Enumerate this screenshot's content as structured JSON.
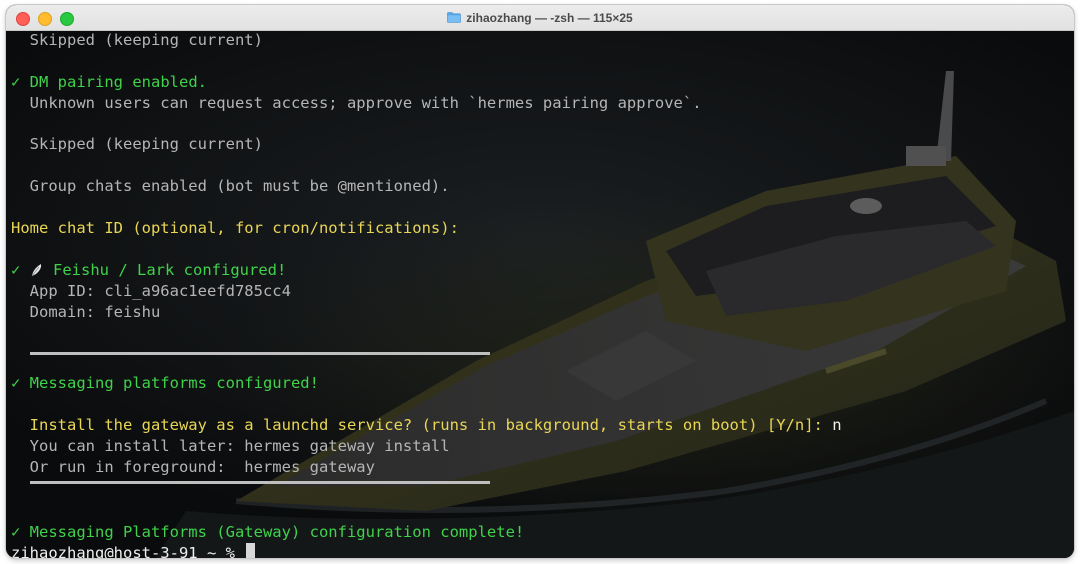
{
  "window": {
    "title": "zihaozhang — -zsh — 115×25"
  },
  "terminal": {
    "lines": [
      {
        "prefix": "",
        "text": "  Skipped (keeping current)",
        "color": "gray"
      },
      {
        "prefix": "",
        "text": "",
        "color": "gray"
      },
      {
        "prefix": "✓",
        "text": " DM pairing enabled.",
        "color": "green"
      },
      {
        "prefix": "",
        "text": "  Unknown users can request access; approve with `hermes pairing approve`.",
        "color": "gray"
      },
      {
        "prefix": "",
        "text": "",
        "color": "gray"
      },
      {
        "prefix": "",
        "text": "  Skipped (keeping current)",
        "color": "gray"
      },
      {
        "prefix": "",
        "text": "",
        "color": "gray"
      },
      {
        "prefix": "",
        "text": "  Group chats enabled (bot must be @mentioned).",
        "color": "gray"
      },
      {
        "prefix": "",
        "text": "",
        "color": "gray"
      },
      {
        "prefix": "",
        "text": "Home chat ID (optional, for cron/notifications):",
        "color": "yellow"
      },
      {
        "prefix": "",
        "text": "",
        "color": "gray"
      },
      {
        "prefix": "✓",
        "text": " Feishu / Lark configured!",
        "color": "green",
        "icon": "feather-icon"
      },
      {
        "prefix": "",
        "text": "  App ID: cli_a96ac1eefd785cc4",
        "color": "gray"
      },
      {
        "prefix": "",
        "text": "  Domain: feishu",
        "color": "gray"
      }
    ],
    "messaging_configured": "✓ Messaging platforms configured!",
    "install_prompt": "Install the gateway as a launchd service? (runs in background, starts on boot) [Y/n]: ",
    "install_answer": "n",
    "install_later": "  You can install later: hermes gateway install",
    "run_foreground": "  Or run in foreground:  hermes gateway",
    "complete": "✓ Messaging Platforms (Gateway) configuration complete!",
    "prompt": "zihaozhang@host-3-91 ~ % "
  }
}
